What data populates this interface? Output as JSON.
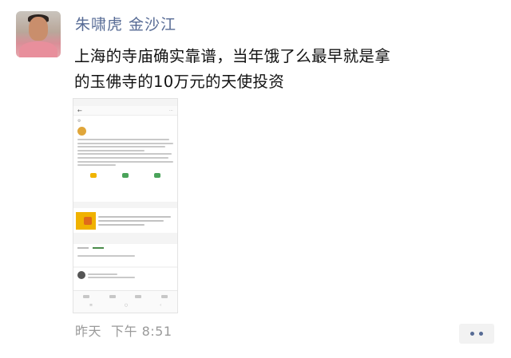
{
  "post": {
    "author_name": "朱啸虎 金沙江",
    "text_lines": [
      "上海的寺庙确实靠谱，当年饿了么最早就是拿",
      "的玉佛寺的10万元的天使投资"
    ],
    "time_day": "昨天",
    "time_clock": "下午 8:51"
  },
  "icons": {
    "more": "more-dots-icon",
    "avatar": "avatar-image"
  },
  "colors": {
    "name_link": "#576b95",
    "body_text": "#111111",
    "timestamp": "#9a9a9a"
  }
}
